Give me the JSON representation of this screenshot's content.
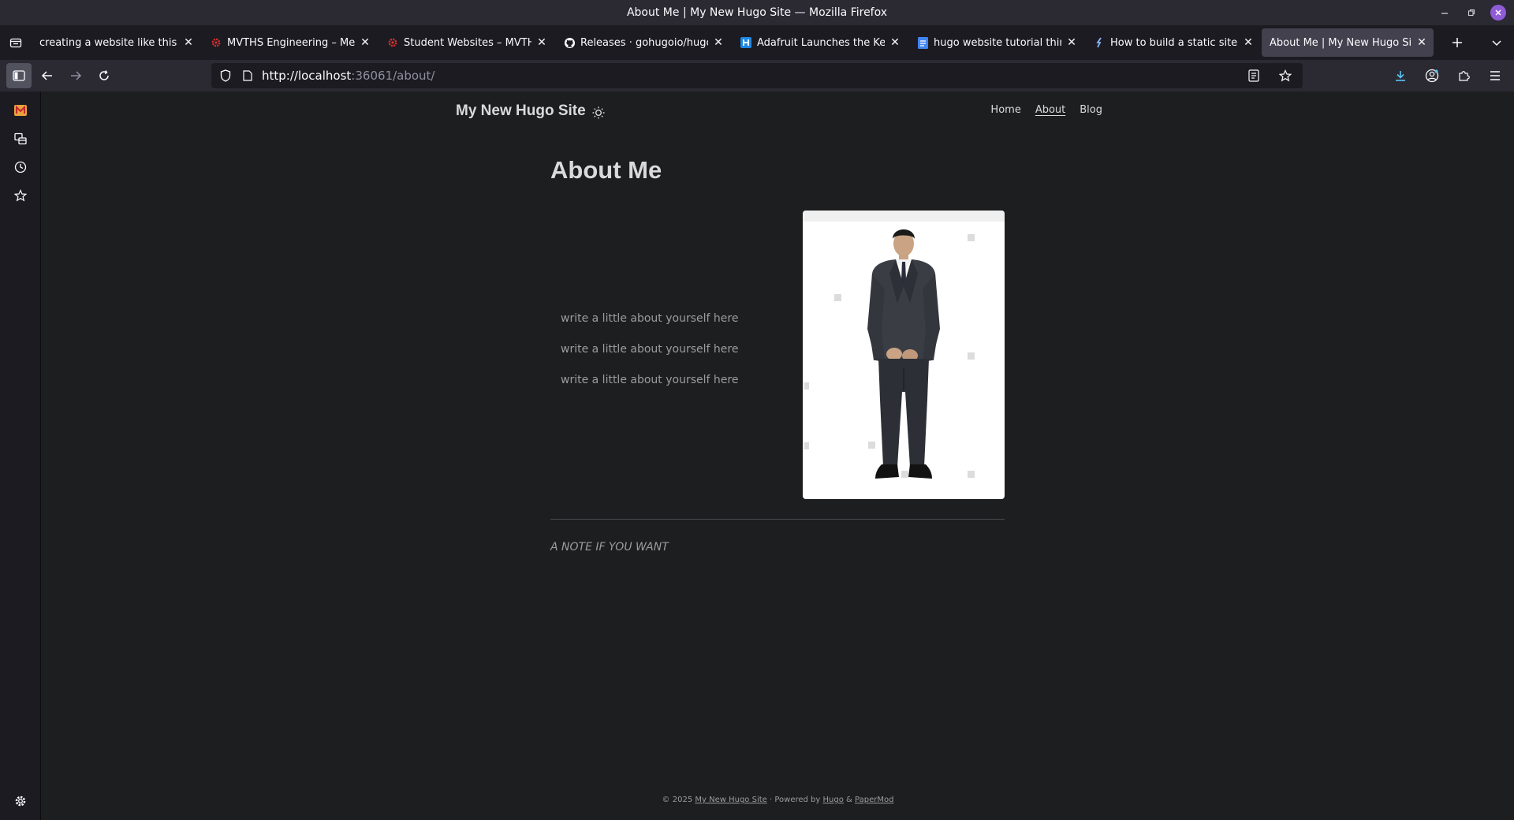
{
  "window": {
    "title": "About Me | My New Hugo Site — Mozilla Firefox"
  },
  "tabs": [
    {
      "label": "creating a website like this using",
      "favicon": "blank-icon",
      "active": false
    },
    {
      "label": "MVTHS Engineering – Medfi",
      "favicon": "gear-red-icon",
      "active": false
    },
    {
      "label": "Student Websites – MVTHS",
      "favicon": "gear-red-icon",
      "active": false
    },
    {
      "label": "Releases · gohugoio/hugo",
      "favicon": "github-icon",
      "active": false
    },
    {
      "label": "Adafruit Launches the Kee B",
      "favicon": "hackster-icon",
      "active": false
    },
    {
      "label": "hugo website tutorial thing",
      "favicon": "docs-icon",
      "active": false
    },
    {
      "label": "How to build a static site wit",
      "favicon": "hugo-icon",
      "active": false
    },
    {
      "label": "About Me | My New Hugo Site",
      "favicon": "none",
      "active": true
    }
  ],
  "urlbar": {
    "host": "http://localhost",
    "path": ":36061/about/"
  },
  "site": {
    "logo": "My New Hugo Site",
    "menu": [
      "Home",
      "About",
      "Blog"
    ],
    "current_menu": "About"
  },
  "post": {
    "title": "About Me",
    "paragraphs": [
      "write a little about yourself here",
      "write a little about yourself here",
      "write a little about yourself here"
    ],
    "note": "A NOTE IF YOU WANT"
  },
  "footer": {
    "prefix": "© 2025",
    "site_link": "My New Hugo Site",
    "powered_by": "· Powered by",
    "hugo": "Hugo",
    "amp": "&",
    "theme": "PaperMod"
  },
  "colors": {
    "page_bg": "#1d1e20",
    "chrome_bg": "#2b2a33",
    "tab_active": "#42414d",
    "accent": "#8f5bd6"
  }
}
